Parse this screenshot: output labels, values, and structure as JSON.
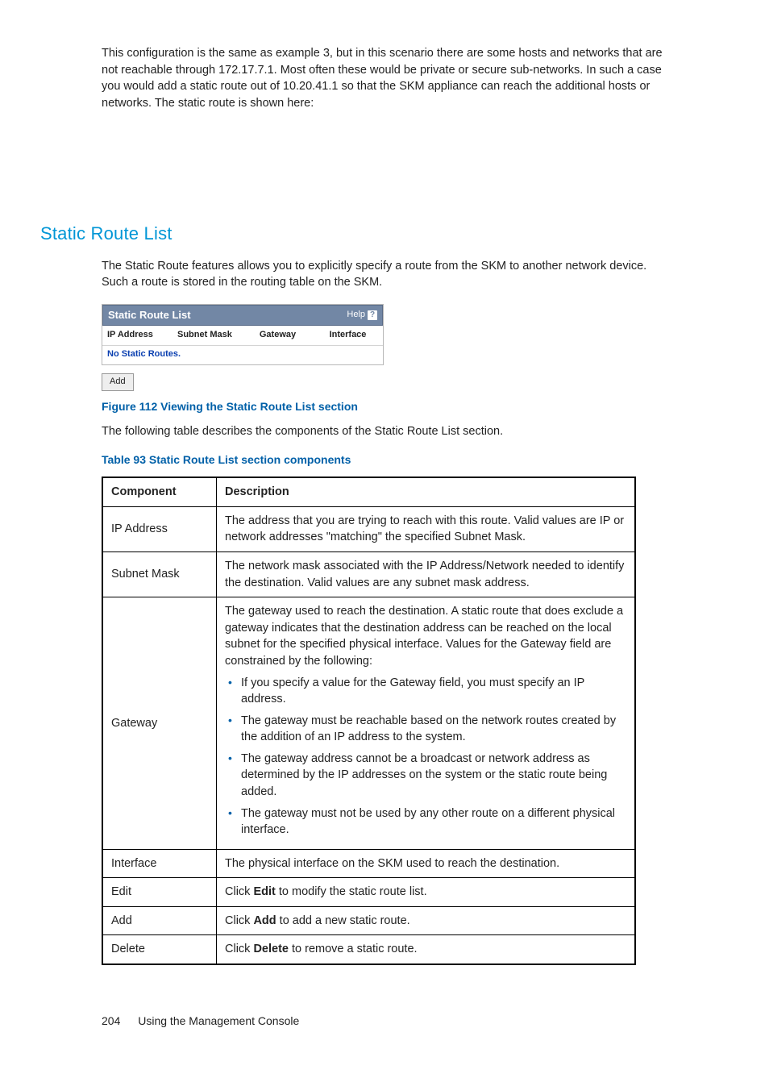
{
  "intro_para": "This configuration is the same as example 3, but in this scenario there are some hosts and networks that are not reachable through 172.17.7.1. Most often these would be private or secure sub-networks. In such a case you would add a static route out of 10.20.41.1 so that the SKM appliance can reach the additional hosts or networks. The static route is shown here:",
  "section_title": "Static Route List",
  "section_para": "The Static Route features allows you to explicitly specify a route from the SKM to another network device. Such a route is stored in the routing table on the SKM.",
  "screenshot": {
    "title": "Static Route List",
    "help": "Help",
    "cols": {
      "ip": "IP Address",
      "mask": "Subnet Mask",
      "gw": "Gateway",
      "if": "Interface"
    },
    "empty_msg": "No Static Routes.",
    "add_btn": "Add"
  },
  "figure_caption": "Figure 112 Viewing the Static Route List section",
  "following_para": "The following table describes the components of the Static Route List section.",
  "table_caption": "Table 93 Static Route List section components",
  "table": {
    "h1": "Component",
    "h2": "Description",
    "rows": {
      "ip": {
        "c": "IP Address",
        "d": "The address that you are trying to reach with this route. Valid values are IP or network addresses \"matching\" the specified Subnet Mask."
      },
      "mask": {
        "c": "Subnet Mask",
        "d": "The network mask associated with the IP Address/Network needed to identify the destination. Valid values are any subnet mask address."
      },
      "gw": {
        "c": "Gateway",
        "d_top": "The gateway used to reach the destination. A static route that does exclude a gateway indicates that the destination address can be reached on the local subnet for the specified physical interface. Values for the Gateway field are constrained by the following:",
        "b1": "If you specify a value for the Gateway field, you must specify an IP address.",
        "b2": "The gateway must be reachable based on the network routes created by the addition of an IP address to the system.",
        "b3": "The gateway address cannot be a broadcast or network address as determined by the IP addresses on the system or the static route being added.",
        "b4": "The gateway must not be used by any other route on a different physical interface."
      },
      "if": {
        "c": "Interface",
        "d": "The physical interface on the SKM used to reach the destination."
      },
      "edit": {
        "c": "Edit",
        "pre": "Click ",
        "bold": "Edit",
        "post": " to modify the static route list."
      },
      "add": {
        "c": "Add",
        "pre": "Click ",
        "bold": "Add",
        "post": " to add a new static route."
      },
      "del": {
        "c": "Delete",
        "pre": "Click ",
        "bold": "Delete",
        "post": " to remove a static route."
      }
    }
  },
  "footer": {
    "page": "204",
    "title": "Using the Management Console"
  }
}
